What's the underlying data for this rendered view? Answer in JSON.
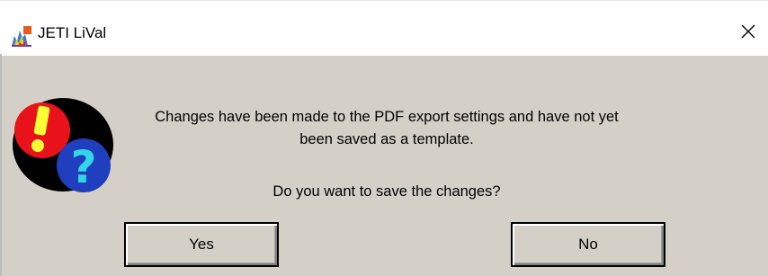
{
  "window": {
    "title": "JETI LiVal",
    "close_glyph": "×"
  },
  "icons": {
    "app": "jeti-lival-app-icon",
    "message": "exclamation-question-icon",
    "close": "close-icon"
  },
  "message": {
    "line1": "Changes have been made to the PDF export settings and have not yet",
    "line2": "been saved as a template.",
    "question": "Do you want to save the changes?"
  },
  "buttons": {
    "yes_label": "Yes",
    "no_label": "No"
  },
  "colors": {
    "dialog_bg": "#d4d0c8",
    "titlebar_bg": "#ffffff",
    "icon_red": "#e8121a",
    "icon_blue": "#1f3fbf",
    "icon_cyan": "#33d6e6",
    "icon_yellow": "#ffff33"
  }
}
